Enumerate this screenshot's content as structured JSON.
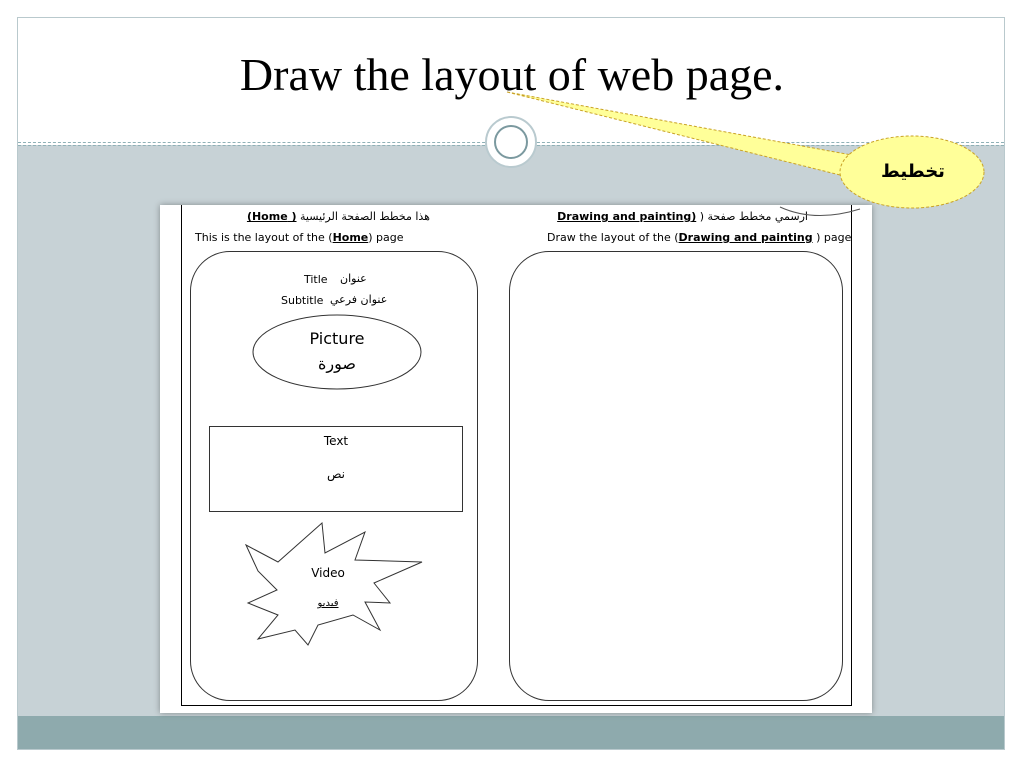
{
  "slide": {
    "title": "Draw the layout of web page.",
    "callout_text": "تخطيط"
  },
  "worksheet": {
    "left_heading_ar": {
      "prefix": "هذا مخطط الصفحة الرئيسية ",
      "bold": "( Home)"
    },
    "left_heading_en": {
      "prefix": "This is the layout of the (",
      "bold": "Home",
      "suffix": ") page"
    },
    "right_heading_ar": {
      "prefix": "ارسمي مخطط صفحة ( ",
      "bold": "(Drawing and painting"
    },
    "right_heading_en": {
      "prefix": "Draw the layout of the (",
      "bold": "Drawing and painting",
      "suffix": " ) page"
    },
    "home_layout": {
      "title_en": "Title",
      "title_ar": "عنوان",
      "subtitle_en": "Subtitle",
      "subtitle_ar": "عنوان فرعي",
      "picture_en": "Picture",
      "picture_ar": "صورة",
      "text_en": "Text",
      "text_ar": "نص",
      "video_en": "Video",
      "video_ar": "فيديو"
    }
  },
  "colors": {
    "content_band": "#c7d2d6",
    "footer_band": "#8eaaad",
    "callout_fill": "#ffff99",
    "callout_stroke": "#c9a227"
  }
}
